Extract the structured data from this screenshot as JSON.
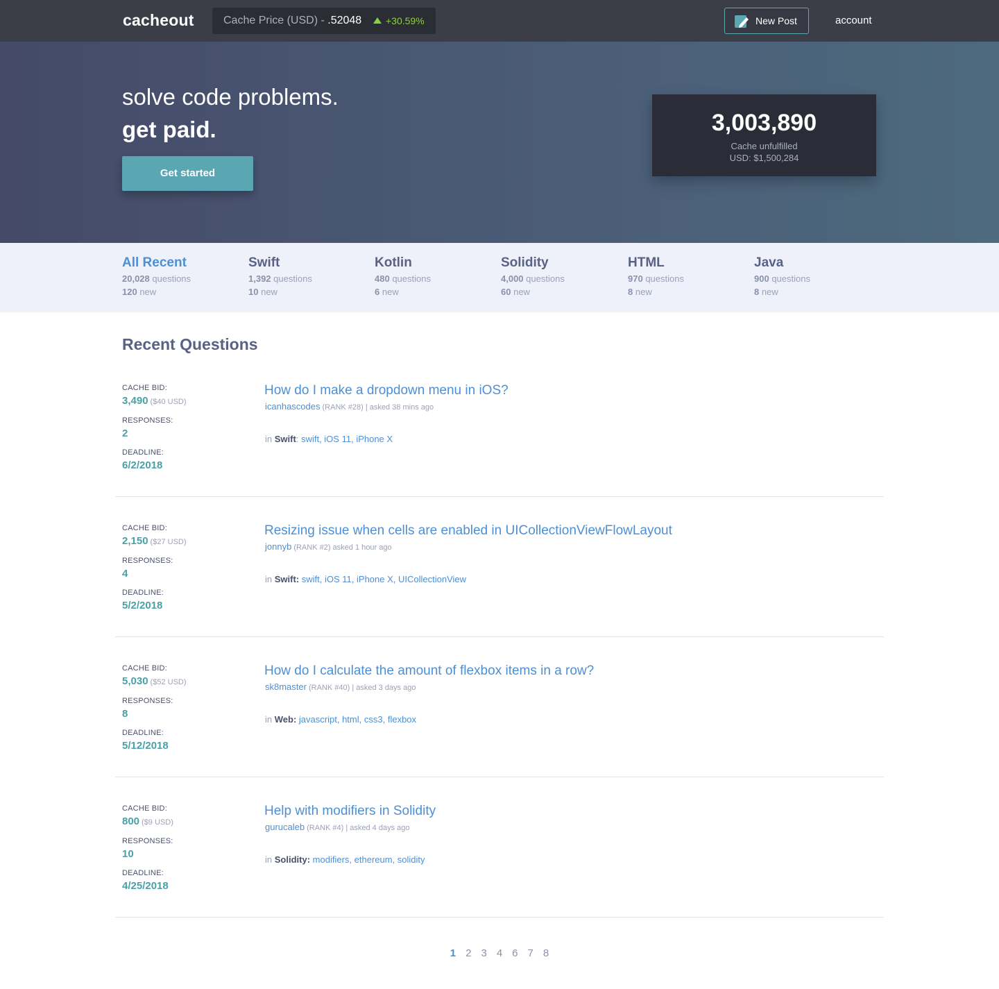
{
  "nav": {
    "brand": "cacheout",
    "ticker_label": "Cache Price (USD) - ",
    "ticker_value": ".52048",
    "ticker_change": "+30.59%",
    "new_post": "New Post",
    "account": "account"
  },
  "hero": {
    "line1": "solve code problems.",
    "line2": "get paid.",
    "cta": "Get started",
    "stats_number": "3,003,890",
    "stats_label": "Cache unfulfilled",
    "stats_usd": "USD: $1,500,284"
  },
  "categories": [
    {
      "name": "All Recent",
      "questions": "20,028",
      "questions_label": "questions",
      "new": "120",
      "new_label": "new",
      "active": true
    },
    {
      "name": "Swift",
      "questions": "1,392",
      "questions_label": "questions",
      "new": "10",
      "new_label": "new"
    },
    {
      "name": "Kotlin",
      "questions": "480",
      "questions_label": "questions",
      "new": "6",
      "new_label": "new"
    },
    {
      "name": "Solidity",
      "questions": "4,000",
      "questions_label": "questions",
      "new": "60",
      "new_label": "new"
    },
    {
      "name": "HTML",
      "questions": "970",
      "questions_label": "questions",
      "new": "8",
      "new_label": "new"
    },
    {
      "name": "Java",
      "questions": "900",
      "questions_label": "questions",
      "new": "8",
      "new_label": "new"
    }
  ],
  "recent": {
    "title": "Recent Questions",
    "labels": {
      "bid": "CACHE BID:",
      "responses": "RESPONSES:",
      "deadline": "DEADLINE:"
    },
    "questions": [
      {
        "bid": "3,490",
        "usd": "($40 USD)",
        "responses": "2",
        "deadline": "6/2/2018",
        "title": "How do I make a dropdown menu in iOS?",
        "user": "icanhascodes",
        "info": "(RANK #28) | asked 38 mins ago",
        "in": "in",
        "category": "Swift",
        "sep": ":",
        "tags": [
          "swift",
          "iOS 11",
          "iPhone X"
        ]
      },
      {
        "bid": "2,150",
        "usd": "($27 USD)",
        "responses": "4",
        "deadline": "5/2/2018",
        "title": "Resizing issue when cells are enabled in UICollectionViewFlowLayout",
        "user": "jonnyb",
        "info": "(RANK #2)   asked 1 hour ago",
        "in": "in",
        "category": "Swift:",
        "sep": "",
        "tags": [
          "swift",
          "iOS 11",
          "iPhone X",
          "UICollectionView"
        ]
      },
      {
        "bid": "5,030",
        "usd": "($52 USD)",
        "responses": "8",
        "deadline": "5/12/2018",
        "title": "How do I calculate the amount of flexbox items in a row?",
        "user": "sk8master",
        "info": "(RANK #40) | asked 3 days ago",
        "in": "in",
        "category": "Web:",
        "sep": "",
        "tags": [
          "javascript",
          "html",
          "css3",
          "flexbox"
        ]
      },
      {
        "bid": "800",
        "usd": "($9 USD)",
        "responses": "10",
        "deadline": "4/25/2018",
        "title": "Help with modifiers in Solidity",
        "user": "gurucaleb",
        "info": "(RANK #4) | asked 4 days ago",
        "in": "in",
        "category": "Solidity:",
        "sep": "",
        "tags": [
          "modifiers",
          "ethereum",
          "solidity"
        ]
      }
    ]
  },
  "pagination": {
    "pages": [
      "1",
      "2",
      "3",
      "4",
      "6",
      "7",
      "8"
    ],
    "current": "1"
  },
  "colors": {
    "accent": "#4d8fd4",
    "teal": "#4aa0a8",
    "nav": "#3b3e47",
    "positive": "#8bd13c"
  }
}
